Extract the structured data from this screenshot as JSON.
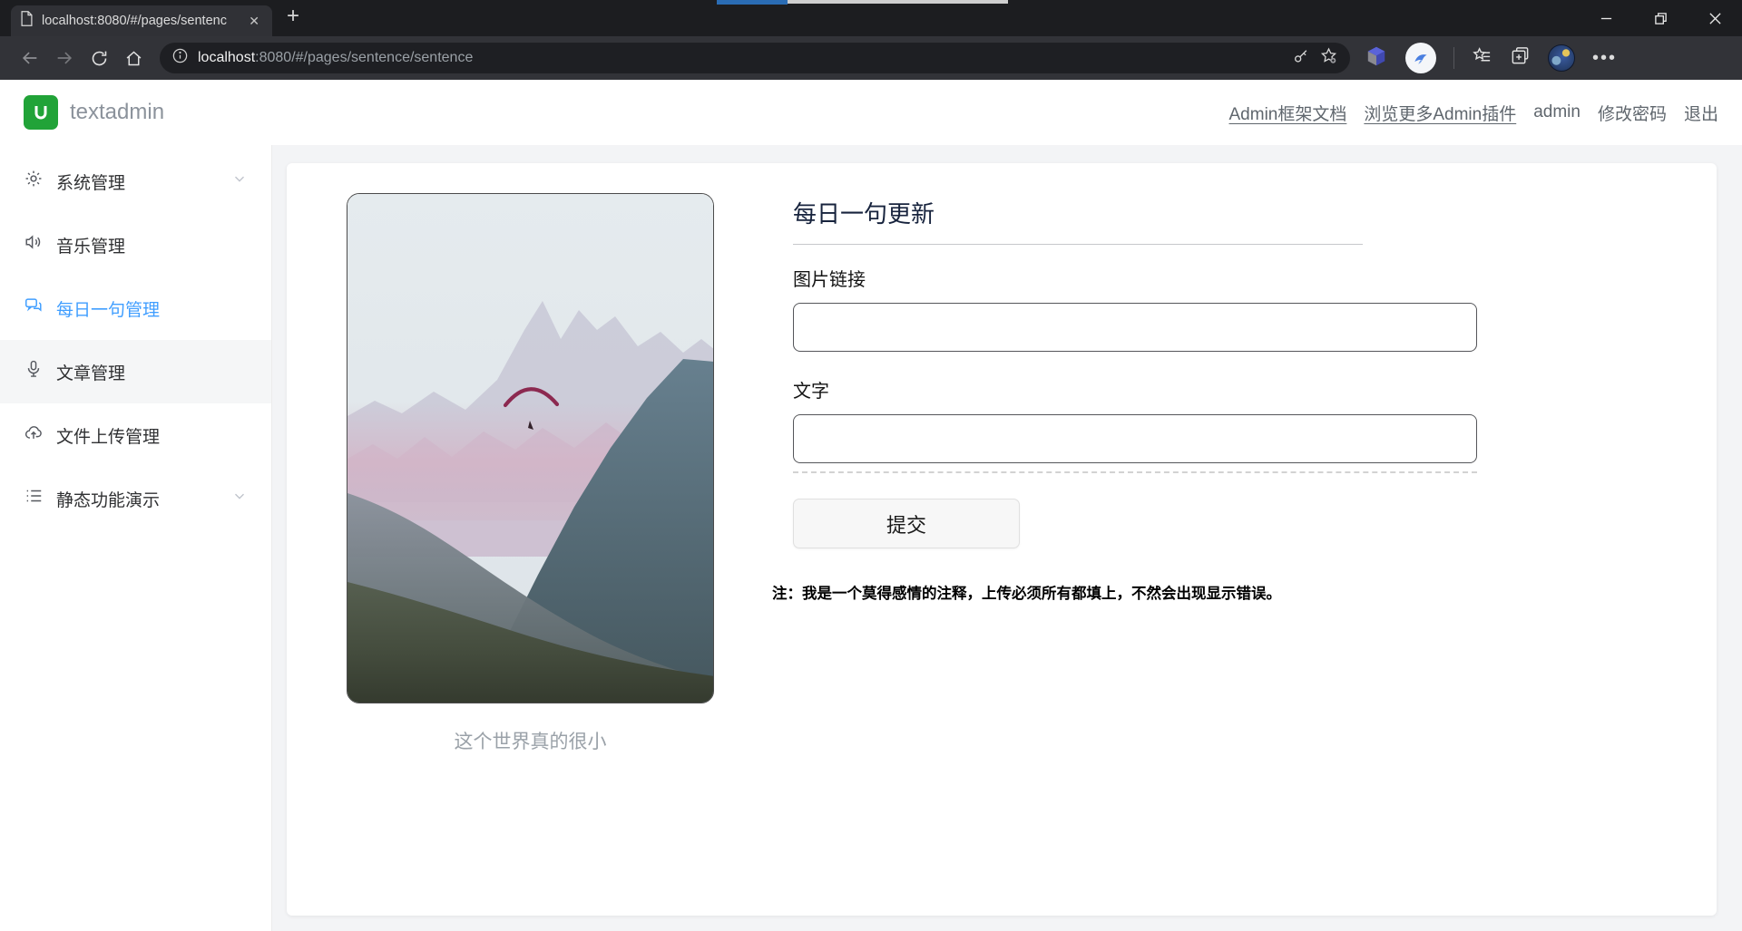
{
  "browser": {
    "tab": {
      "title": "localhost:8080/#/pages/sentenc",
      "close_glyph": "✕",
      "new_tab_glyph": "+"
    },
    "url": {
      "host": "localhost",
      "path": ":8080/#/pages/sentence/sentence"
    },
    "toolbar_icons": [
      "back-icon",
      "forward-icon",
      "refresh-icon",
      "home-icon",
      "info-icon",
      "key-icon",
      "star-add-icon",
      "cube-extension-icon",
      "bird-extension-icon",
      "favorites-icon",
      "collections-icon",
      "avatar",
      "more-icon"
    ],
    "more_glyph": "•••"
  },
  "header": {
    "brand": "textadmin",
    "links": [
      {
        "label": "Admin框架文档",
        "underlined": true
      },
      {
        "label": "浏览更多Admin插件",
        "underlined": true
      },
      {
        "label": "admin",
        "underlined": false
      },
      {
        "label": "修改密码",
        "underlined": false
      },
      {
        "label": "退出",
        "underlined": false
      }
    ]
  },
  "sidebar": {
    "items": [
      {
        "label": "系统管理",
        "icon": "gear-icon",
        "active": false,
        "chevron": true
      },
      {
        "label": "音乐管理",
        "icon": "speaker-icon",
        "active": false,
        "chevron": false
      },
      {
        "label": "每日一句管理",
        "icon": "chat-bubbles-icon",
        "active": true,
        "chevron": false
      },
      {
        "label": "文章管理",
        "icon": "microphone-icon",
        "active": false,
        "chevron": false
      },
      {
        "label": "文件上传管理",
        "icon": "cloud-upload-icon",
        "active": false,
        "chevron": false
      },
      {
        "label": "静态功能演示",
        "icon": "list-icon",
        "active": false,
        "chevron": true
      }
    ]
  },
  "main": {
    "image_caption": "这个世界真的很小",
    "form": {
      "title": "每日一句更新",
      "fields": [
        {
          "label": "图片链接",
          "value": ""
        },
        {
          "label": "文字",
          "value": ""
        }
      ],
      "submit_label": "提交",
      "note": "注：我是一个莫得感情的注释，上传必须所有都填上，不然会出现显示错误。"
    }
  },
  "colors": {
    "accent_blue": "#409eff",
    "brand_green": "#21a338",
    "titlebar": "#1c1d20",
    "toolbar": "#323338",
    "paraglider": "#8c2950"
  }
}
